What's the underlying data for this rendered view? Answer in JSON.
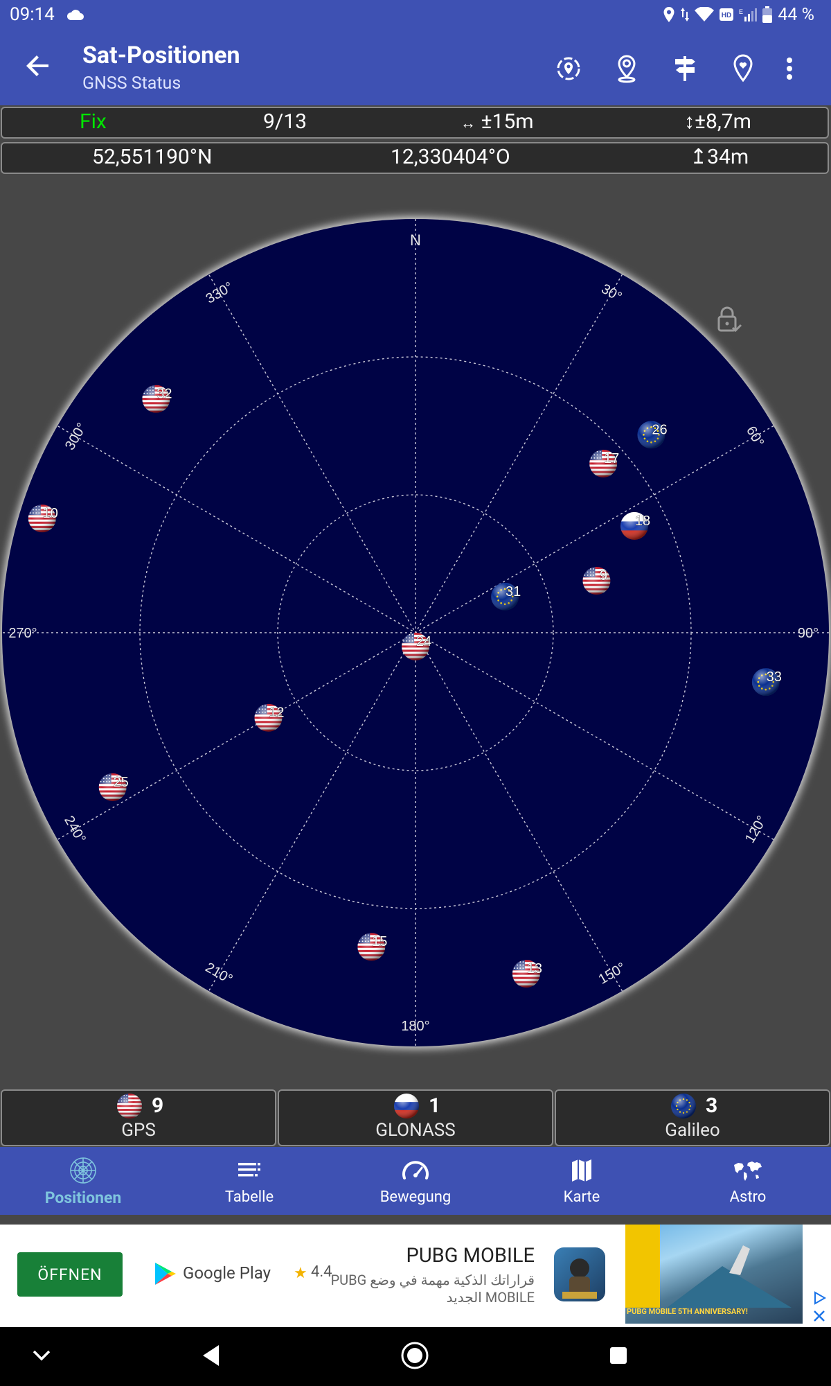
{
  "status_bar": {
    "time": "09:14",
    "battery": "44 %",
    "icons": [
      "cloud-icon",
      "location-icon",
      "data-arrows-icon",
      "wifi-icon",
      "hd-volte-icon",
      "signal-icon",
      "battery-icon"
    ]
  },
  "app_bar": {
    "title": "Sat-Positionen",
    "subtitle": "GNSS Status",
    "actions": [
      "gps-target-icon",
      "map-pin-icon",
      "signpost-icon",
      "favorite-pin-icon",
      "more-vert-icon"
    ]
  },
  "fix_info": {
    "status": "Fix",
    "status_color": "#00e600",
    "sats": "9/13",
    "horizontal_accuracy": "±15m",
    "vertical_accuracy": "±8,7m"
  },
  "position": {
    "latitude": "52,551190°N",
    "longitude": "12,330404°O",
    "altitude": "34m"
  },
  "skyplot": {
    "north_label": "N",
    "background": "#000345",
    "azimuth_labels": [
      {
        "azimuth": 30,
        "text": "30°"
      },
      {
        "azimuth": 60,
        "text": "60°"
      },
      {
        "azimuth": 90,
        "text": "90°"
      },
      {
        "azimuth": 120,
        "text": "120°"
      },
      {
        "azimuth": 150,
        "text": "150°"
      },
      {
        "azimuth": 180,
        "text": "180°"
      },
      {
        "azimuth": 210,
        "text": "210°"
      },
      {
        "azimuth": 240,
        "text": "240°"
      },
      {
        "azimuth": 270,
        "text": "270°"
      },
      {
        "azimuth": 300,
        "text": "300°"
      },
      {
        "azimuth": 330,
        "text": "330°"
      }
    ],
    "satellites": [
      {
        "id": "32",
        "system": "gps",
        "azimuth": 312,
        "elevation": 14
      },
      {
        "id": "10",
        "system": "gps",
        "azimuth": 287,
        "elevation": 5
      },
      {
        "id": "25",
        "system": "gps",
        "azimuth": 243,
        "elevation": 16
      },
      {
        "id": "12",
        "system": "gps",
        "azimuth": 240,
        "elevation": 53
      },
      {
        "id": "24",
        "system": "gps",
        "azimuth": 180,
        "elevation": 87
      },
      {
        "id": "15",
        "system": "gps",
        "azimuth": 188,
        "elevation": 21
      },
      {
        "id": "13",
        "system": "gps",
        "azimuth": 162,
        "elevation": 12
      },
      {
        "id": "17",
        "system": "gps",
        "azimuth": 48,
        "elevation": 35
      },
      {
        "id": "9",
        "system": "gps",
        "azimuth": 74,
        "elevation": 49
      },
      {
        "id": "18",
        "system": "glonass",
        "azimuth": 64,
        "elevation": 37
      },
      {
        "id": "26",
        "system": "galileo",
        "azimuth": 50,
        "elevation": 23
      },
      {
        "id": "31",
        "system": "galileo",
        "azimuth": 68,
        "elevation": 69
      },
      {
        "id": "33",
        "system": "galileo",
        "azimuth": 98,
        "elevation": 13
      }
    ],
    "lock_icon": "lock-check-icon"
  },
  "systems": [
    {
      "name": "GPS",
      "count": "9",
      "flag": "usa-flag-icon"
    },
    {
      "name": "GLONASS",
      "count": "1",
      "flag": "russia-flag-icon"
    },
    {
      "name": "Galileo",
      "count": "3",
      "flag": "eu-flag-icon"
    }
  ],
  "bottom_nav": [
    {
      "label": "Positionen",
      "icon": "skyplot-icon",
      "active": true
    },
    {
      "label": "Tabelle",
      "icon": "list-icon",
      "active": false
    },
    {
      "label": "Bewegung",
      "icon": "speedometer-icon",
      "active": false
    },
    {
      "label": "Karte",
      "icon": "map-icon",
      "active": false
    },
    {
      "label": "Astro",
      "icon": "world-map-icon",
      "active": false
    }
  ],
  "ad": {
    "open_label": "ÖFFNEN",
    "store": "Google Play",
    "rating": "4.4",
    "title": "PUBG MOBILE",
    "description": "قراراتك الذكية مهمة في وضع PUBG MOBILE الجديد",
    "image_caption": "PUBG MOBILE 5TH ANNIVERSARY!"
  },
  "colors": {
    "primary": "#3e51b3",
    "active_nav": "#7fc5de",
    "ad_button": "#188038"
  }
}
